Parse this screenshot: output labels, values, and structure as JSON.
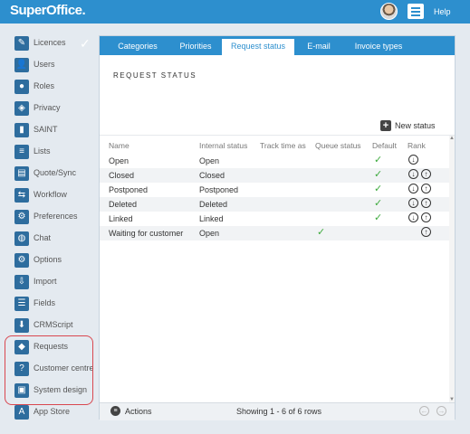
{
  "app": {
    "logo": "SuperOffice.",
    "help_label": "Help"
  },
  "sidebar": {
    "items": [
      {
        "label": "Licences",
        "icon": "licence-icon",
        "glyph": "✎"
      },
      {
        "label": "Users",
        "icon": "user-icon",
        "glyph": "👤"
      },
      {
        "label": "Roles",
        "icon": "roles-icon",
        "glyph": "●"
      },
      {
        "label": "Privacy",
        "icon": "shield-icon",
        "glyph": "◈"
      },
      {
        "label": "SAINT",
        "icon": "bar-chart-icon",
        "glyph": "▮"
      },
      {
        "label": "Lists",
        "icon": "list-icon",
        "glyph": "≡"
      },
      {
        "label": "Quote/Sync",
        "icon": "quote-icon",
        "glyph": "▤"
      },
      {
        "label": "Workflow",
        "icon": "workflow-icon",
        "glyph": "⇆"
      },
      {
        "label": "Preferences",
        "icon": "preferences-gear-icon",
        "glyph": "⚙"
      },
      {
        "label": "Chat",
        "icon": "chat-bubble-icon",
        "glyph": "◍"
      },
      {
        "label": "Options",
        "icon": "options-gear-icon",
        "glyph": "⚙"
      },
      {
        "label": "Import",
        "icon": "import-icon",
        "glyph": "⇩"
      },
      {
        "label": "Fields",
        "icon": "fields-icon",
        "glyph": "☰"
      },
      {
        "label": "CRMScript",
        "icon": "crmscript-icon",
        "glyph": "⬇"
      },
      {
        "label": "Requests",
        "icon": "requests-tag-icon",
        "glyph": "◆"
      },
      {
        "label": "Customer centre",
        "icon": "customer-centre-icon",
        "glyph": "?"
      },
      {
        "label": "System design",
        "icon": "system-design-icon",
        "glyph": "▣"
      },
      {
        "label": "App Store",
        "icon": "app-store-icon",
        "glyph": "A"
      }
    ]
  },
  "tabs": [
    {
      "label": "Categories"
    },
    {
      "label": "Priorities"
    },
    {
      "label": "Request status"
    },
    {
      "label": "E-mail"
    },
    {
      "label": "Invoice types"
    }
  ],
  "active_tab": "Request status",
  "section_title": "REQUEST STATUS",
  "new_status_label": "New status",
  "table": {
    "columns": [
      "Name",
      "Internal status",
      "Track time as",
      "Queue status",
      "Default",
      "Rank"
    ],
    "rows": [
      {
        "name": "Open",
        "internal": "Open",
        "track": "",
        "queue": false,
        "default": true,
        "rank_down": true,
        "rank_up": false
      },
      {
        "name": "Closed",
        "internal": "Closed",
        "track": "",
        "queue": false,
        "default": true,
        "rank_down": true,
        "rank_up": true
      },
      {
        "name": "Postponed",
        "internal": "Postponed",
        "track": "",
        "queue": false,
        "default": true,
        "rank_down": true,
        "rank_up": true
      },
      {
        "name": "Deleted",
        "internal": "Deleted",
        "track": "",
        "queue": false,
        "default": true,
        "rank_down": true,
        "rank_up": true
      },
      {
        "name": "Linked",
        "internal": "Linked",
        "track": "",
        "queue": false,
        "default": true,
        "rank_down": true,
        "rank_up": true
      },
      {
        "name": "Waiting for customer",
        "internal": "Open",
        "track": "",
        "queue": true,
        "default": false,
        "rank_down": false,
        "rank_up": true
      }
    ]
  },
  "footer": {
    "actions_label": "Actions",
    "showing": "Showing 1 - 6 of 6 rows"
  },
  "colors": {
    "accent": "#2d8fce",
    "check": "#3eaa3e",
    "highlight": "#d9474f"
  }
}
